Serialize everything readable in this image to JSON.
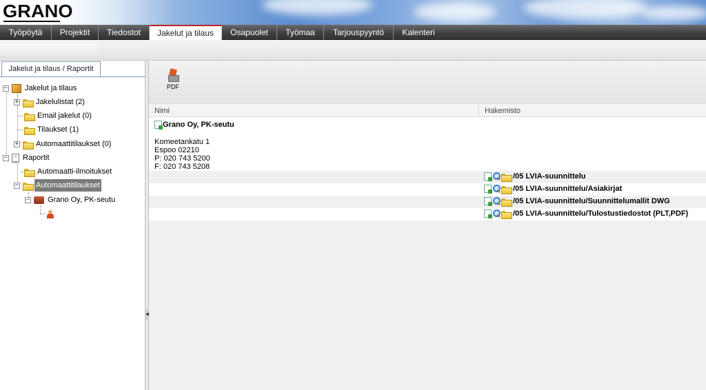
{
  "app": {
    "logo": "GRANO"
  },
  "tabs": [
    {
      "label": "Työpöytä"
    },
    {
      "label": "Projektit"
    },
    {
      "label": "Tiedostot"
    },
    {
      "label": "Jakelut ja tilaus",
      "active": true
    },
    {
      "label": "Osapuolet"
    },
    {
      "label": "Työmaa"
    },
    {
      "label": "Tarjouspyyntö"
    },
    {
      "label": "Kalenteri"
    }
  ],
  "left_panel": {
    "tab_label": "Jakelut ja tilaus / Raportit",
    "tree": {
      "jakelut_root": "Jakelut ja tilaus",
      "jakelulistat": "Jakelulistat (2)",
      "email_jakelut": "Email jakelut (0)",
      "tilaukset": "Tilaukset (1)",
      "automaattitilaukset_0": "Automaattitilaukset (0)",
      "raportit_root": "Raportit",
      "automaatti_ilmoitukset": "Automaatti-ilmoitukset",
      "automaattitilaukset_sel": "Automaattitilaukset",
      "grano_node": "Grano Oy, PK-seutu"
    }
  },
  "toolbar": {
    "pdf_label": "PDF"
  },
  "grid": {
    "columns": {
      "nimi": "Nimi",
      "hakemisto": "Hakemisto"
    },
    "company": {
      "name": "Grano Oy, PK-seutu",
      "street": "Komeetankatu 1",
      "city": "Espoo 02210",
      "phone": "P: 020 743 5200",
      "fax": "F: 020 743 5208"
    },
    "directories": [
      "/05 LVIA-suunnittelu",
      "/05 LVIA-suunnittelu/Asiakirjat",
      "/05 LVIA-suunnittelu/Suunnittelumallit DWG",
      "/05 LVIA-suunnittelu/Tulostustiedostot (PLT,PDF)"
    ]
  },
  "colors": {
    "tab_active_accent": "#b22222",
    "selected_node_bg": "#7a7a7a"
  }
}
